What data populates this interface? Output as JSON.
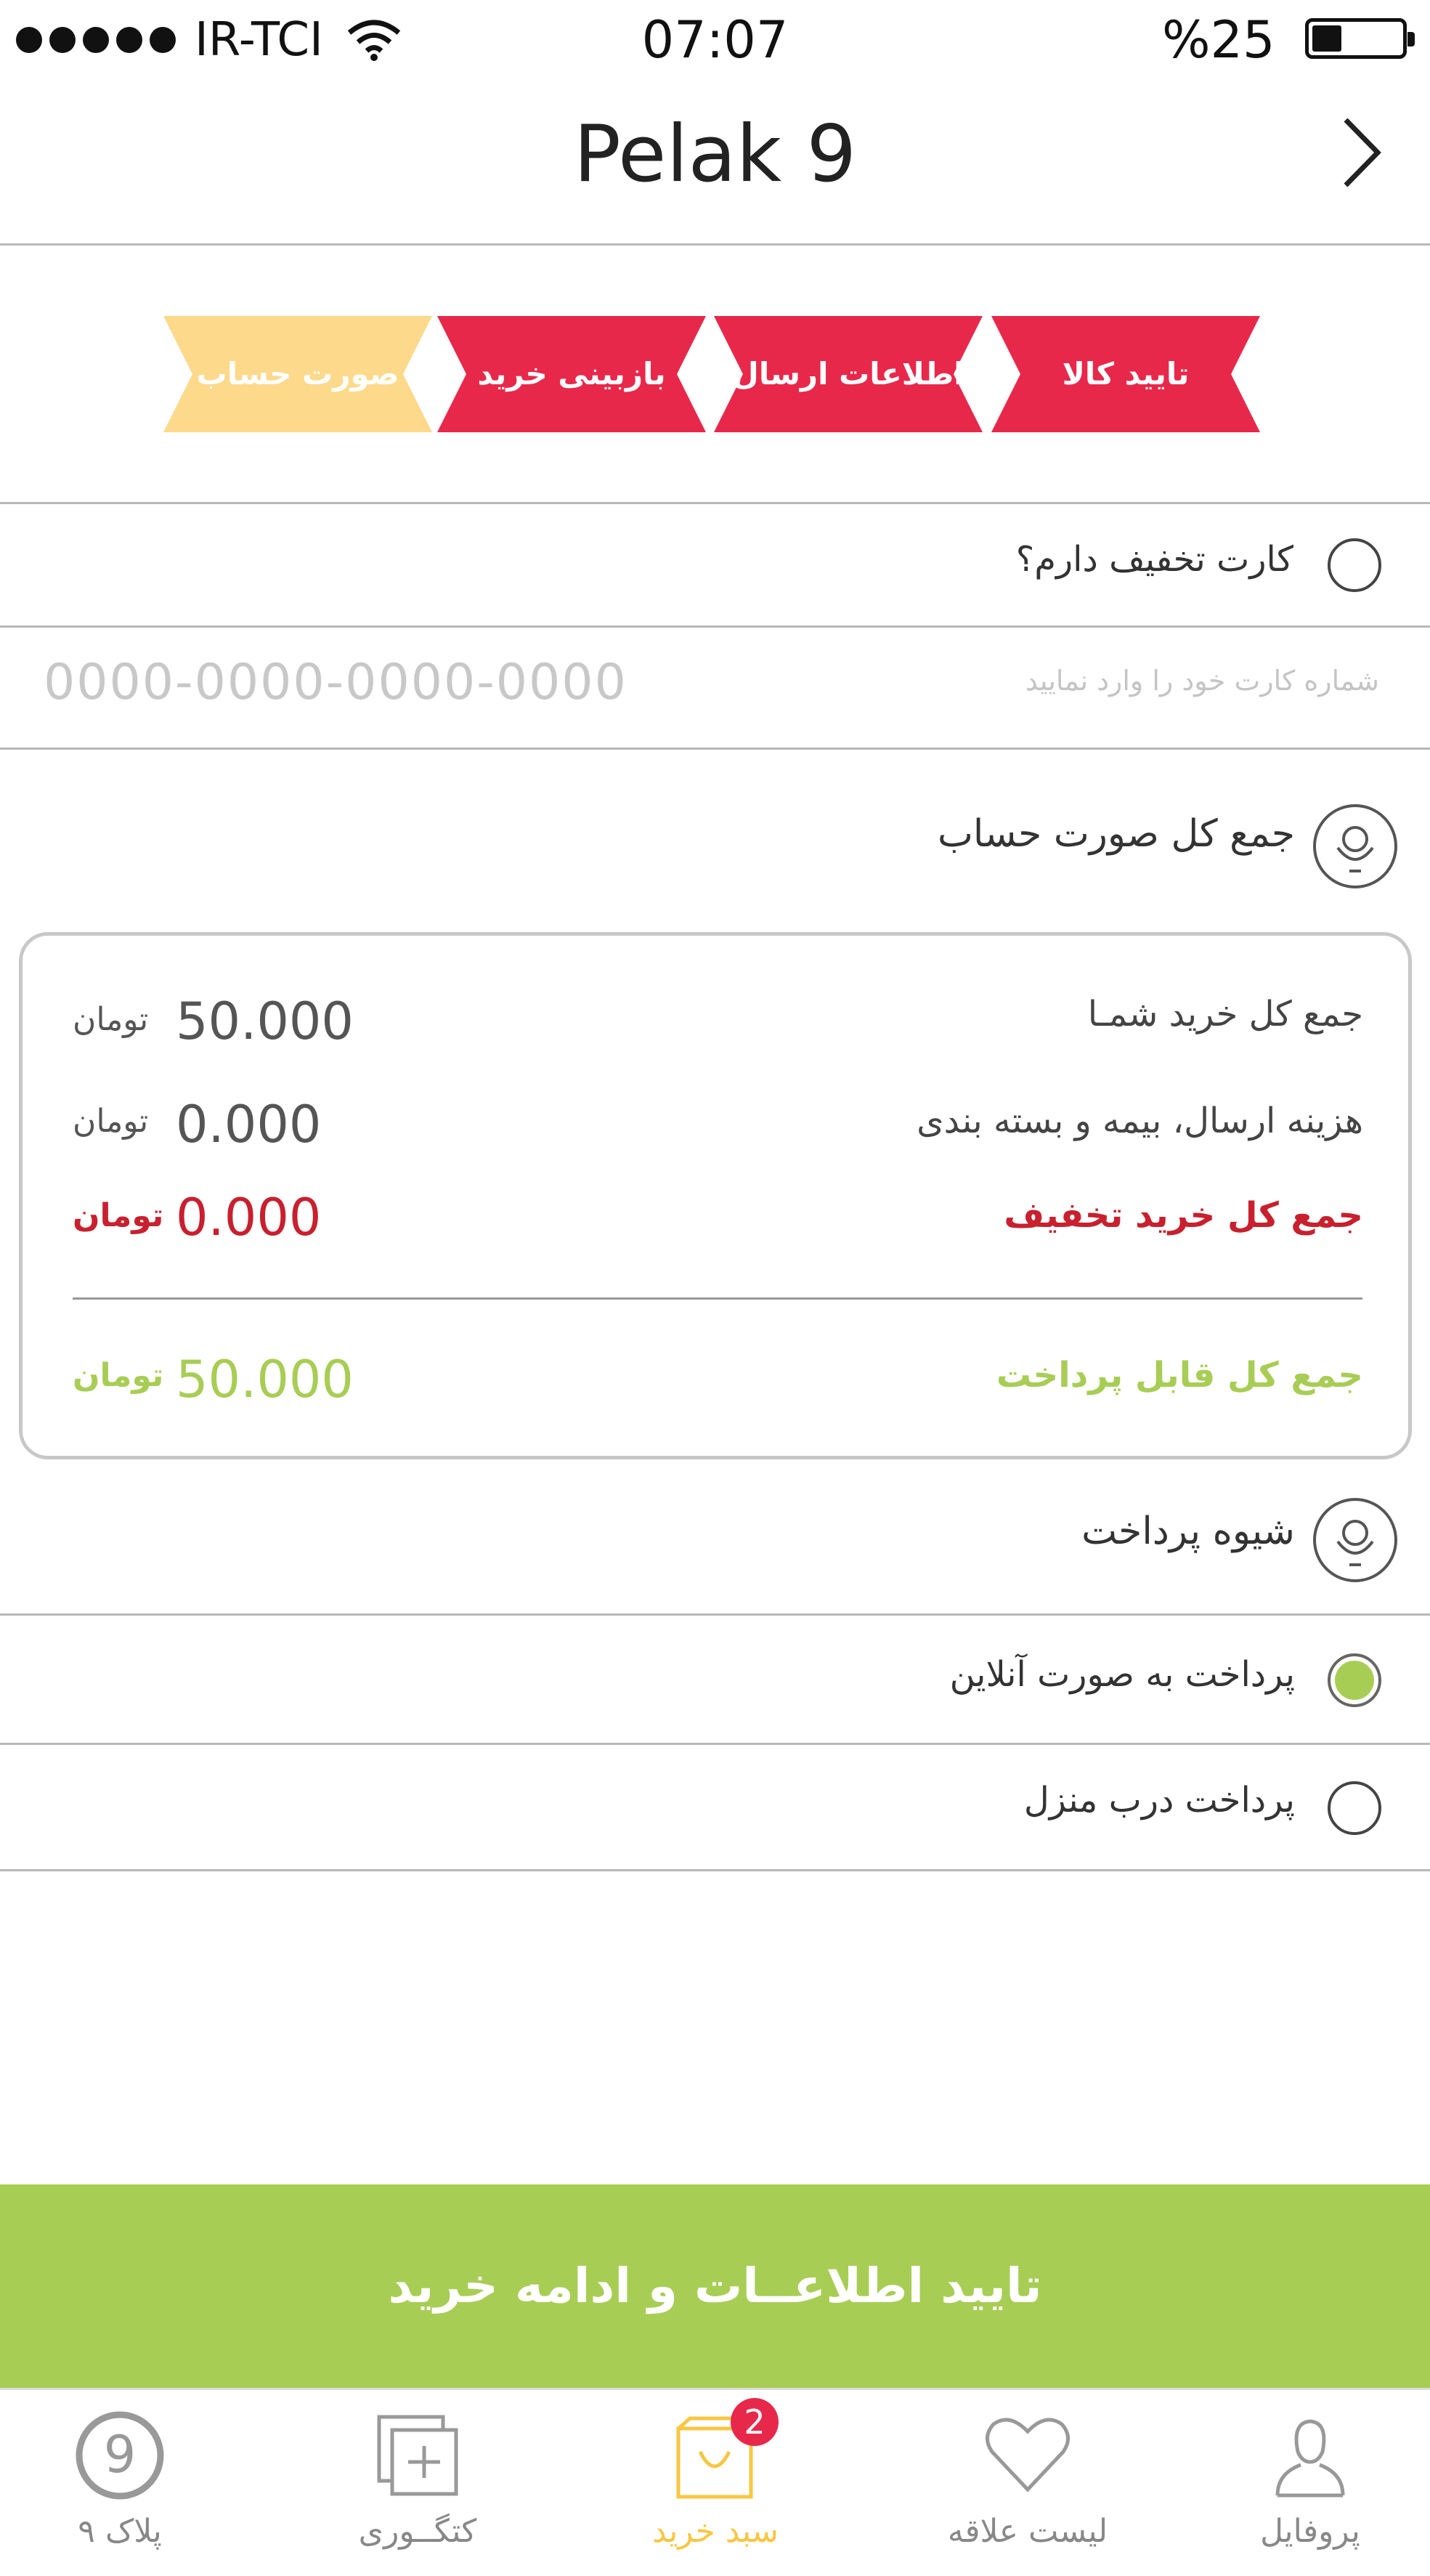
{
  "status_bar": {
    "carrier": "IR-TCI",
    "time": "07:07",
    "battery": "%25"
  },
  "nav": {
    "title": "Pelak 9"
  },
  "steps": [
    {
      "label": "تایید کالا",
      "color": "#e8284a"
    },
    {
      "label": "اطلاعات ارسال",
      "color": "#e8284a"
    },
    {
      "label": "بازبینی خرید",
      "color": "#e8284a"
    },
    {
      "label": "صورت حساب",
      "color": "#fcd98b"
    }
  ],
  "discount": {
    "question": "کارت تخفیف دارم؟",
    "hint": "شماره کارت خود را وارد نمایید",
    "placeholder": "0000-0000-0000-0000"
  },
  "summary": {
    "title": "جمع کل صورت حساب",
    "rows": [
      {
        "label": "جمع کل خرید شمـا",
        "amount": "50.000",
        "currency": "تومان",
        "color": "#444444"
      },
      {
        "label": "هزینه ارسال، بیمه و بسته بندی",
        "amount": "0.000",
        "currency": "تومان",
        "color": "#444444"
      },
      {
        "label": "جمع کل خرید تخفیف",
        "amount": "0.000",
        "currency": "تومان",
        "color": "#c8202e"
      }
    ],
    "total": {
      "label": "جمع کل قابل پرداخت",
      "amount": "50.000",
      "currency": "تومان",
      "color": "#a8cd55"
    }
  },
  "payment": {
    "title": "شیوه پرداخت",
    "options": [
      {
        "label": "پرداخت به صورت آنلاین",
        "selected": true
      },
      {
        "label": "پرداخت درب منزل",
        "selected": false
      }
    ]
  },
  "cta": {
    "label": "تایید اطلاعــات و ادامه خرید"
  },
  "tabs": [
    {
      "label": "پلاک ۹",
      "icon": "pelak-logo-icon"
    },
    {
      "label": "کتگــوری",
      "icon": "category-icon"
    },
    {
      "label": "سبد خرید",
      "icon": "cart-icon",
      "badge": "2",
      "active": true
    },
    {
      "label": "لیست علاقه",
      "icon": "heart-icon"
    },
    {
      "label": "پروفایل",
      "icon": "profile-icon"
    }
  ],
  "tab_logo_digit": "9",
  "colors": {
    "accent_green": "#a8cd55",
    "step_red": "#e8284a",
    "step_yellow": "#fcd98b",
    "active_tab": "#f8c642"
  }
}
